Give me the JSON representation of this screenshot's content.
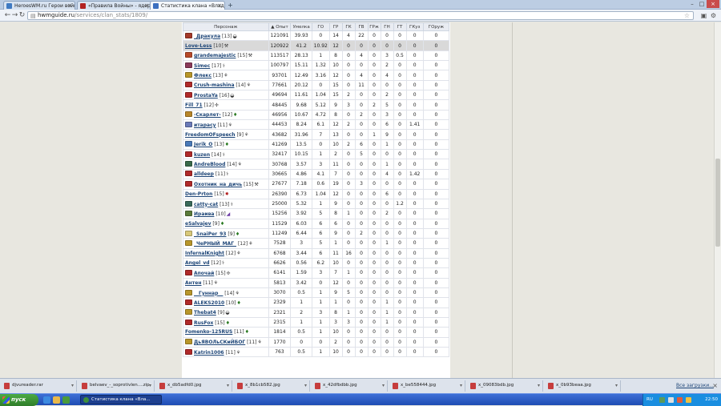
{
  "browser": {
    "tabs": [
      {
        "title": "HeroesWM.ru Герои войны и",
        "icon_color": "#3f7ac2",
        "active": false
      },
      {
        "title": "«Правила Войны» - ядерная с",
        "icon_color": "#b22222",
        "active": false
      },
      {
        "title": "Статистика клана «Владею",
        "icon_color": "#3c6fbf",
        "active": true
      }
    ],
    "new_tab_label": "+",
    "window_controls": [
      "–",
      "□",
      "×"
    ],
    "nav": {
      "back": "←",
      "forward": "→",
      "reload": "↻"
    },
    "url_host": "hwmguide.ru",
    "url_path": "/services/clan_stats/1809/",
    "star_icon": "☆"
  },
  "table": {
    "headers": [
      "Персонаж",
      "▲ Опыт",
      "Умелка",
      "ГО",
      "ГР",
      "ГК",
      "ГВ",
      "ГРж",
      "ГН",
      "ГТ",
      "ГКуз",
      "ГОруж"
    ],
    "rows": [
      {
        "name": "_Дракула",
        "level": "[13]",
        "icon": "#a53a2a",
        "badge": "◒",
        "badge_color": "",
        "hl": false,
        "vals": [
          "121091",
          "39.93",
          "0",
          "14",
          "4",
          "22",
          "0",
          "0",
          "0",
          "0",
          "0"
        ]
      },
      {
        "name": "Love-Less",
        "level": "[10]",
        "icon": "",
        "badge": "⚒",
        "badge_color": "",
        "hl": true,
        "vals": [
          "120922",
          "41.2",
          "10.92",
          "12",
          "0",
          "0",
          "0",
          "0",
          "0",
          "0",
          "0"
        ]
      },
      {
        "name": "grandemajestic",
        "level": "[15]",
        "icon": "#b84a2a",
        "badge": "⚒",
        "badge_color": "",
        "hl": false,
        "vals": [
          "113517",
          "28.13",
          "1",
          "8",
          "0",
          "4",
          "0",
          "3",
          "0.5",
          "0",
          "0"
        ]
      },
      {
        "name": "Simec",
        "level": "[17]",
        "icon": "#8a3a5a",
        "badge": "⚕",
        "badge_color": "",
        "hl": false,
        "vals": [
          "100797",
          "15.11",
          "1.32",
          "10",
          "0",
          "0",
          "0",
          "2",
          "0",
          "0",
          "0"
        ]
      },
      {
        "name": "Флекс",
        "level": "[13]",
        "icon": "#b8962a",
        "badge": "⚘",
        "badge_color": "",
        "hl": false,
        "vals": [
          "93701",
          "12.49",
          "3.16",
          "12",
          "0",
          "4",
          "0",
          "4",
          "0",
          "0",
          "0"
        ]
      },
      {
        "name": "Crush-mashina",
        "level": "[14]",
        "icon": "#b02a2a",
        "badge": "⚘",
        "badge_color": "",
        "hl": false,
        "vals": [
          "77661",
          "20.12",
          "0",
          "15",
          "0",
          "11",
          "0",
          "0",
          "0",
          "0",
          "0"
        ]
      },
      {
        "name": "ProstaYa",
        "level": "[16]",
        "icon": "#b02a2a",
        "badge": "◒",
        "badge_color": "",
        "hl": false,
        "vals": [
          "49694",
          "11.61",
          "1.04",
          "15",
          "2",
          "0",
          "0",
          "2",
          "0",
          "0",
          "0"
        ]
      },
      {
        "name": "Fill_71",
        "level": "[12]",
        "icon": "",
        "badge": "✢",
        "badge_color": "",
        "hl": false,
        "vals": [
          "48445",
          "9.68",
          "5.12",
          "9",
          "3",
          "0",
          "2",
          "5",
          "0",
          "0",
          "0"
        ]
      },
      {
        "name": "-Скарлет-",
        "level": "[12]",
        "icon": "#b8862a",
        "badge": "♦",
        "badge_color": "green",
        "hl": false,
        "vals": [
          "46956",
          "10.67",
          "4.72",
          "8",
          "0",
          "2",
          "0",
          "3",
          "0",
          "0",
          "0"
        ]
      },
      {
        "name": "итарасу",
        "level": "[11]",
        "icon": "#6a7ab8",
        "badge": "⚘",
        "badge_color": "",
        "hl": false,
        "vals": [
          "44453",
          "8.24",
          "6.1",
          "12",
          "2",
          "0",
          "0",
          "6",
          "0",
          "1.41",
          "0"
        ]
      },
      {
        "name": "FreedomOFspeech",
        "level": "[9]",
        "icon": "",
        "badge": "⚘",
        "badge_color": "",
        "hl": false,
        "vals": [
          "43682",
          "31.96",
          "7",
          "13",
          "0",
          "0",
          "1",
          "9",
          "0",
          "0",
          "0"
        ]
      },
      {
        "name": "Jerik_O",
        "level": "[13]",
        "icon": "#4a7ab8",
        "badge": "♦",
        "badge_color": "green",
        "hl": false,
        "vals": [
          "41269",
          "13.5",
          "0",
          "10",
          "2",
          "6",
          "0",
          "1",
          "0",
          "0",
          "0"
        ]
      },
      {
        "name": "kuzen",
        "level": "[14]",
        "icon": "#b02a2a",
        "badge": "⚕",
        "badge_color": "",
        "hl": false,
        "vals": [
          "32417",
          "10.15",
          "1",
          "2",
          "0",
          "5",
          "0",
          "0",
          "0",
          "0",
          "0"
        ]
      },
      {
        "name": "AndreBlood",
        "level": "[14]",
        "icon": "#3a6a4a",
        "badge": "⚘",
        "badge_color": "",
        "hl": false,
        "vals": [
          "30768",
          "3.57",
          "3",
          "11",
          "0",
          "0",
          "0",
          "1",
          "0",
          "0",
          "0"
        ]
      },
      {
        "name": "alldeep",
        "level": "[11]",
        "icon": "#b02a2a",
        "badge": "⚕",
        "badge_color": "",
        "hl": false,
        "vals": [
          "30665",
          "4.86",
          "4.1",
          "7",
          "0",
          "0",
          "0",
          "4",
          "0",
          "1.42",
          "0"
        ]
      },
      {
        "name": "Охотник_на_дичь",
        "level": "[15]",
        "icon": "#b02a2a",
        "badge": "⚒",
        "badge_color": "",
        "hl": false,
        "vals": [
          "27677",
          "7.18",
          "0.6",
          "19",
          "0",
          "3",
          "0",
          "0",
          "0",
          "0",
          "0"
        ]
      },
      {
        "name": "Den-Prton",
        "level": "[15]",
        "icon": "",
        "badge": "✸",
        "badge_color": "red",
        "hl": false,
        "vals": [
          "26390",
          "6.73",
          "1.04",
          "12",
          "0",
          "0",
          "0",
          "6",
          "0",
          "0",
          "0"
        ]
      },
      {
        "name": "catty-cat",
        "level": "[13]",
        "icon": "#3a6a5a",
        "badge": "⚕",
        "badge_color": "",
        "hl": false,
        "vals": [
          "25000",
          "5.32",
          "1",
          "9",
          "0",
          "0",
          "0",
          "0",
          "1.2",
          "0",
          "0"
        ]
      },
      {
        "name": "Ираива",
        "level": "[10]",
        "icon": "#5a7a3a",
        "badge": "◢",
        "badge_color": "purple",
        "hl": false,
        "vals": [
          "15256",
          "3.92",
          "5",
          "8",
          "1",
          "0",
          "0",
          "2",
          "0",
          "0",
          "0"
        ]
      },
      {
        "name": "eSalvajev",
        "level": "[9]",
        "icon": "",
        "badge": "♦",
        "badge_color": "green",
        "hl": false,
        "vals": [
          "11529",
          "6.03",
          "6",
          "6",
          "0",
          "0",
          "0",
          "0",
          "0",
          "0",
          "0"
        ]
      },
      {
        "name": "_SnaiPer_93",
        "level": "[9]",
        "icon": "#d8c87a",
        "badge": "♦",
        "badge_color": "green",
        "hl": false,
        "vals": [
          "11249",
          "6.44",
          "6",
          "9",
          "0",
          "2",
          "0",
          "0",
          "0",
          "0",
          "0"
        ]
      },
      {
        "name": "_ЧеРНЫЙ_МАГ_",
        "level": "[12]",
        "icon": "#b8962a",
        "badge": "⚘",
        "badge_color": "",
        "hl": false,
        "vals": [
          "7528",
          "3",
          "5",
          "1",
          "0",
          "0",
          "0",
          "1",
          "0",
          "0",
          "0"
        ]
      },
      {
        "name": "InfernalKnight",
        "level": "[12]",
        "icon": "",
        "badge": "⚘",
        "badge_color": "",
        "hl": false,
        "vals": [
          "6768",
          "3.44",
          "6",
          "11",
          "16",
          "0",
          "0",
          "0",
          "0",
          "0",
          "0"
        ]
      },
      {
        "name": "Angel_vd",
        "level": "[12]",
        "icon": "",
        "badge": "⚕",
        "badge_color": "",
        "hl": false,
        "vals": [
          "6626",
          "0.56",
          "6.2",
          "10",
          "0",
          "0",
          "0",
          "0",
          "0",
          "0",
          "0"
        ]
      },
      {
        "name": "Апочай",
        "level": "[15]",
        "icon": "#b02a2a",
        "badge": "✢",
        "badge_color": "",
        "hl": false,
        "vals": [
          "6141",
          "1.59",
          "3",
          "7",
          "1",
          "0",
          "0",
          "0",
          "0",
          "0",
          "0"
        ]
      },
      {
        "name": "Антен",
        "level": "[11]",
        "icon": "",
        "badge": "⚘",
        "badge_color": "",
        "hl": false,
        "vals": [
          "5813",
          "3.42",
          "0",
          "12",
          "0",
          "0",
          "0",
          "0",
          "0",
          "0",
          "0"
        ]
      },
      {
        "name": "__Гуннар__",
        "level": "[14]",
        "icon": "#b8962a",
        "badge": "⚘",
        "badge_color": "",
        "hl": false,
        "vals": [
          "3070",
          "0.5",
          "1",
          "9",
          "5",
          "0",
          "0",
          "0",
          "0",
          "0",
          "0"
        ]
      },
      {
        "name": "ALEKS2010",
        "level": "[10]",
        "icon": "#b02a2a",
        "badge": "♦",
        "badge_color": "green",
        "hl": false,
        "vals": [
          "2329",
          "1",
          "1",
          "1",
          "0",
          "0",
          "0",
          "1",
          "0",
          "0",
          "0"
        ]
      },
      {
        "name": "Thebat4",
        "level": "[9]",
        "icon": "#b8962a",
        "badge": "◒",
        "badge_color": "",
        "hl": false,
        "vals": [
          "2321",
          "2",
          "3",
          "8",
          "1",
          "0",
          "0",
          "1",
          "0",
          "0",
          "0"
        ]
      },
      {
        "name": "RusFox",
        "level": "[15]",
        "icon": "#b02a2a",
        "badge": "♦",
        "badge_color": "green",
        "hl": false,
        "vals": [
          "2315",
          "1",
          "1",
          "3",
          "3",
          "0",
          "0",
          "1",
          "0",
          "0",
          "0"
        ]
      },
      {
        "name": "Fomenko-125RUS",
        "level": "[11]",
        "icon": "",
        "badge": "♦",
        "badge_color": "green",
        "hl": false,
        "vals": [
          "1814",
          "0.5",
          "1",
          "10",
          "0",
          "0",
          "0",
          "0",
          "0",
          "0",
          "0"
        ]
      },
      {
        "name": "ДьЯВОЛьСКиЙБОГ",
        "level": "[11]",
        "icon": "#b8962a",
        "badge": "⚘",
        "badge_color": "",
        "hl": false,
        "vals": [
          "1770",
          "0",
          "0",
          "2",
          "0",
          "0",
          "0",
          "0",
          "0",
          "0",
          "0"
        ]
      },
      {
        "name": "Katrin1006",
        "level": "[11]",
        "icon": "#b02a2a",
        "badge": "⚘",
        "badge_color": "",
        "hl": false,
        "vals": [
          "763",
          "0.5",
          "1",
          "10",
          "0",
          "0",
          "0",
          "0",
          "0",
          "0",
          "0"
        ]
      }
    ]
  },
  "downloads": {
    "items": [
      "djvureader.rar",
      "belvaev_-_soprotivlen....zip",
      "x_db5adfd0.jpg",
      "x_8b1cb582.jpg",
      "x_42dfbdbb.jpg",
      "x_be558444.jpg",
      "x_09083bdb.jpg",
      "x_0b93beaa.jpg"
    ],
    "show_all": "Все загрузки..."
  },
  "taskbar": {
    "start": "пуск",
    "window_item": "Статистика клана «Вла...",
    "lang": "RU",
    "clock": "22:50"
  }
}
